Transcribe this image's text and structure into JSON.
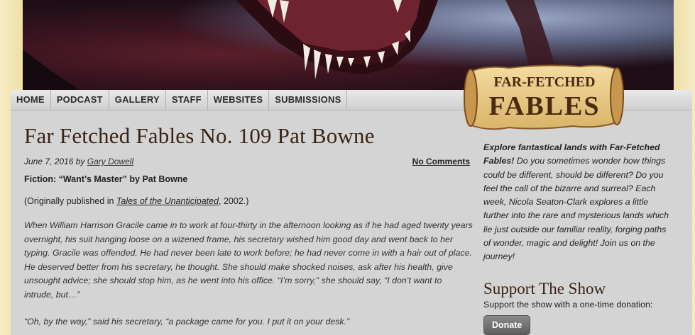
{
  "nav": {
    "items": [
      "HOME",
      "PODCAST",
      "GALLERY",
      "STAFF",
      "WEBSITES",
      "SUBMISSIONS"
    ]
  },
  "logo": {
    "line1": "FAR-FETCHED",
    "line2": "FABLES"
  },
  "post": {
    "title": "Far Fetched Fables No. 109 Pat Bowne",
    "date": "June 7, 2016",
    "by": "by",
    "author": "Gary Dowell",
    "comments": "No Comments",
    "fiction": "Fiction: “Want’s Master” by Pat Bowne",
    "orig_prefix": "(Originally published in ",
    "orig_link": "Tales of the Unanticipated",
    "orig_suffix": ", 2002.)",
    "paragraph1": "When William Harrison Gracile came in to work at four-thirty in the afternoon looking as if he had aged twenty years overnight, his suit hanging loose on a wizened frame, his secretary wished him good day and went back to her typing. Gracile was offended. He had never been late to work before; he had never come in with a hair out of place. He deserved better from his secretary, he thought. She should make shocked noises, ask after his health, give unsought advice; she should stop him, as he went into his office. “I’m sorry,” she should say, “I don’t want to intrude, but…”",
    "paragraph2": "“Oh, by the way,” said his secretary, “a package came for you. I put it on your desk.”"
  },
  "sidebar": {
    "intro_bold": "Explore fantastical lands with Far-Fetched Fables!",
    "intro_rest": " Do you sometimes wonder how things could be different, should be different? Do you feel the call of the bizarre and surreal? Each week, Nicola Seaton-Clark explores a little further into the rare and mysterious lands which lie just outside our familiar reality, forging paths of wonder, magic and delight! Join us on the journey!",
    "support_title": "Support The Show",
    "support_sub": "Support the show with a one-time donation:",
    "donate_label": "Donate"
  },
  "colors": {
    "background": "#f4e7b4",
    "content": "#d4d4d4",
    "title": "#3a2417",
    "logo_text": "#4a2a12"
  }
}
